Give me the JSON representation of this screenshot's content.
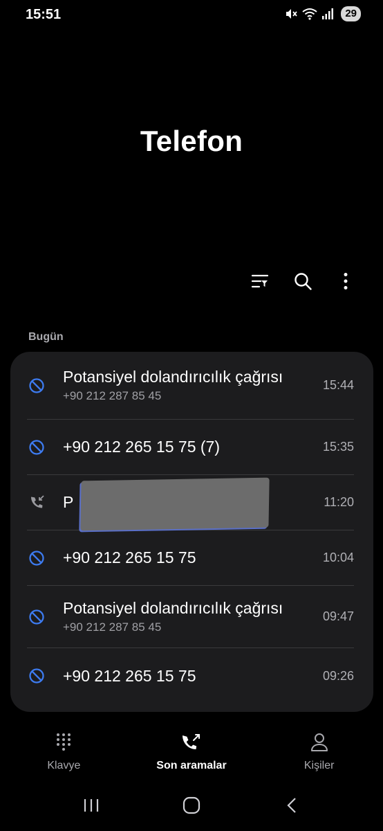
{
  "status_bar": {
    "time": "15:51",
    "battery": "29",
    "icons": [
      "mute-icon",
      "wifi-icon",
      "signal-icon"
    ]
  },
  "title": "Telefon",
  "toolbar": {
    "icons": [
      "filter-icon",
      "search-icon",
      "more-vert-icon"
    ]
  },
  "section_label": "Bugün",
  "colors": {
    "blocked_icon": "#3d7bf0",
    "card_bg": "#1c1c1e",
    "secondary_text": "#a0a0a5"
  },
  "calls": [
    {
      "type": "blocked",
      "title": "Potansiyel dolandırıcılık çağrısı",
      "subtitle": "+90 212 287 85 45",
      "time": "15:44"
    },
    {
      "type": "blocked",
      "title": "+90 212 265 15 75 (7)",
      "subtitle": "",
      "time": "15:35"
    },
    {
      "type": "incoming",
      "title": "P",
      "subtitle": "",
      "time": "11:20"
    },
    {
      "type": "blocked",
      "title": "+90 212 265 15 75",
      "subtitle": "",
      "time": "10:04"
    },
    {
      "type": "blocked",
      "title": "Potansiyel dolandırıcılık çağrısı",
      "subtitle": "+90 212 287 85 45",
      "time": "09:47"
    },
    {
      "type": "blocked",
      "title": "+90 212 265 15 75",
      "subtitle": "",
      "time": "09:26"
    }
  ],
  "bottom_nav": {
    "keypad": "Klavye",
    "recents": "Son aramalar",
    "contacts": "Kişiler"
  }
}
